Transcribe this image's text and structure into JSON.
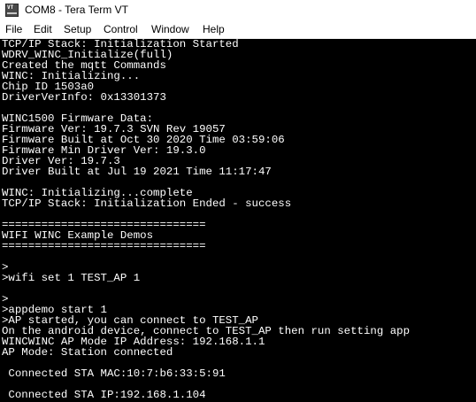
{
  "window": {
    "title": "COM8 - Tera Term VT",
    "app_icon_text": "VT"
  },
  "menu": {
    "items": [
      "File",
      "Edit",
      "Setup",
      "Control",
      "Window",
      "Help"
    ]
  },
  "terminal": {
    "background": "#000000",
    "foreground": "#ffffff",
    "lines": [
      "TCP/IP Stack: Initialization Started",
      "WDRV_WINC_Initialize(full)",
      "Created the mqtt Commands",
      "WINC: Initializing...",
      "Chip ID 1503a0",
      "DriverVerInfo: 0x13301373",
      "",
      "WINC1500 Firmware Data:",
      "Firmware Ver: 19.7.3 SVN Rev 19057",
      "Firmware Built at Oct 30 2020 Time 03:59:06",
      "Firmware Min Driver Ver: 19.3.0",
      "Driver Ver: 19.7.3",
      "Driver Built at Jul 19 2021 Time 11:17:47",
      "",
      "WINC: Initializing...complete",
      "TCP/IP Stack: Initialization Ended - success",
      "",
      "===============================",
      "WIFI WINC Example Demos",
      "===============================",
      "",
      ">",
      ">wifi set 1 TEST_AP 1",
      "",
      ">",
      ">appdemo start 1",
      ">AP started, you can connect to TEST_AP",
      "On the android device, connect to TEST_AP then run setting app",
      "WINCWINC AP Mode IP Address: 192.168.1.1",
      "AP Mode: Station connected",
      "",
      " Connected STA MAC:10:7:b6:33:5:91",
      "",
      " Connected STA IP:192.168.1.104"
    ]
  }
}
